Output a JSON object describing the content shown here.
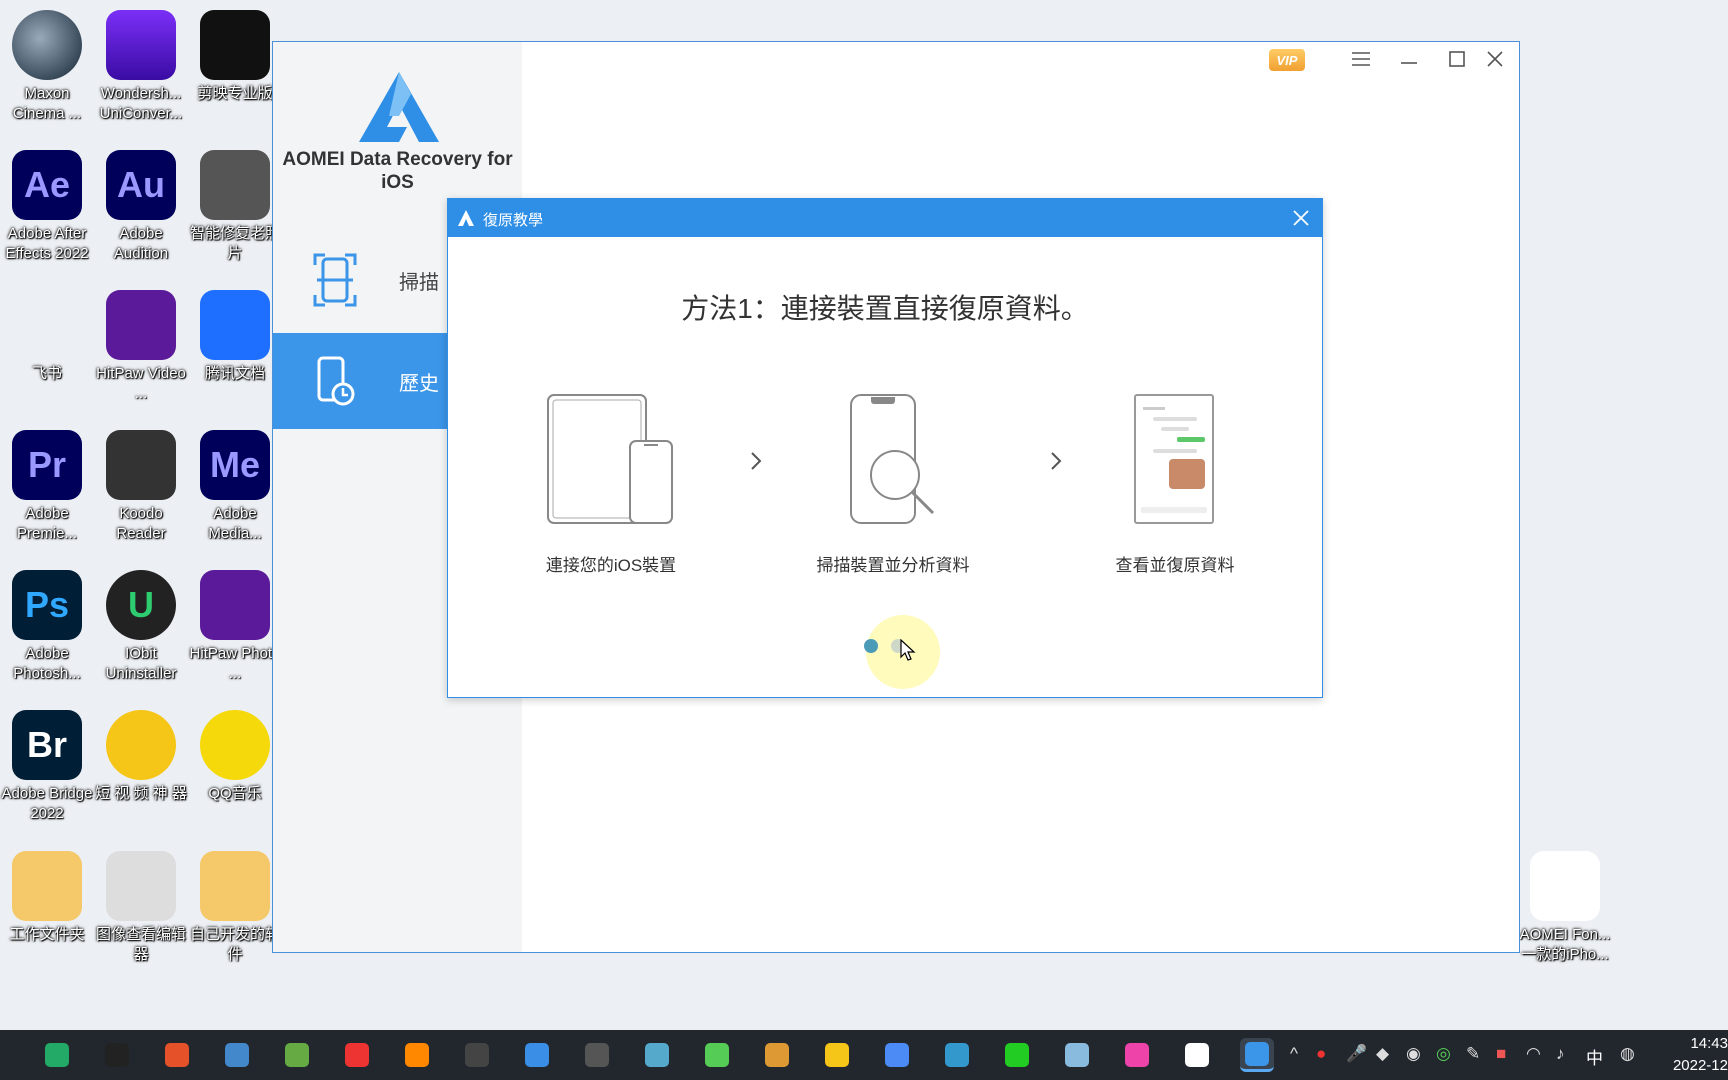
{
  "desktop": {
    "icons": [
      {
        "label": "Maxon Cinema ...",
        "icon": "cinema4d-icon"
      },
      {
        "label": "Wondersh... UniConver...",
        "icon": "uniconverter-icon"
      },
      {
        "label": "剪映专业版",
        "icon": "capcut-icon"
      },
      {
        "label": "Adobe After Effects 2022",
        "icon": "after-effects-icon",
        "glyph": "Ae"
      },
      {
        "label": "Adobe Audition",
        "icon": "audition-icon",
        "glyph": "Au"
      },
      {
        "label": "智能修复老照片",
        "icon": "photo-repair-icon"
      },
      {
        "label": "飞书",
        "icon": "feishu-icon"
      },
      {
        "label": "HitPaw Video ...",
        "icon": "hitpaw-video-icon"
      },
      {
        "label": "腾讯文档",
        "icon": "tencent-docs-icon"
      },
      {
        "label": "Adobe Premie...",
        "icon": "premiere-icon",
        "glyph": "Pr"
      },
      {
        "label": "Koodo Reader",
        "icon": "koodo-reader-icon"
      },
      {
        "label": "Adobe Media...",
        "icon": "media-encoder-icon",
        "glyph": "Me"
      },
      {
        "label": "Adobe Photosh...",
        "icon": "photoshop-icon",
        "glyph": "Ps"
      },
      {
        "label": "IObit Uninstaller",
        "icon": "iobit-uninstaller-icon",
        "glyph": "U"
      },
      {
        "label": "HitPaw Photo ...",
        "icon": "hitpaw-photo-icon"
      },
      {
        "label": "Adobe Bridge 2022",
        "icon": "bridge-icon",
        "glyph": "Br"
      },
      {
        "label": "短 视 频 神 器",
        "icon": "short-video-tool-icon"
      },
      {
        "label": "QQ音乐",
        "icon": "qq-music-icon"
      },
      {
        "label": "工作文件夹",
        "icon": "folder-icon"
      },
      {
        "label": "图像查看编辑器",
        "icon": "image-viewer-icon"
      },
      {
        "label": "自己开发的软件",
        "icon": "folder-icon"
      },
      {
        "label": "AOMEI Fon... 一款的iPho...",
        "icon": "aomei-fonetool-icon"
      }
    ]
  },
  "app": {
    "title": "AOMEI Data Recovery for iOS",
    "vip_label": "VIP",
    "nav": [
      {
        "label": "掃描",
        "icon": "scan-icon",
        "active": false
      },
      {
        "label": "歷史",
        "icon": "history-icon",
        "active": true
      }
    ],
    "accent": "#3b95e8"
  },
  "dialog": {
    "title": "復原教學",
    "method": "方法1：連接裝置直接復原資料。",
    "steps": [
      {
        "label": "連接您的iOS裝置",
        "icon": "devices-icon"
      },
      {
        "label": "掃描裝置並分析資料",
        "icon": "phone-search-icon"
      },
      {
        "label": "查看並復原資料",
        "icon": "phone-messages-icon"
      }
    ],
    "page_count": 2,
    "current_page": 1,
    "header_color": "#2f8ee6"
  },
  "taskbar": {
    "apps": [
      "windows-defender-icon",
      "koodo-icon",
      "foxit-icon",
      "printer-icon",
      "feishu-icon",
      "obs-recorder-icon",
      "search-tool-icon",
      "obs-studio-icon",
      "translate-icon",
      "password-manager-icon",
      "bird-app-icon",
      "panda-app-icon",
      "package-icon",
      "file-explorer-icon",
      "chrome-icon",
      "feishu-docs-icon",
      "qq-music-icon",
      "cloud-drive-icon",
      "color-app-icon",
      "cat-app-icon",
      "aomei-icon"
    ],
    "ime": "中",
    "time": "14:43",
    "date": "2022-12"
  }
}
